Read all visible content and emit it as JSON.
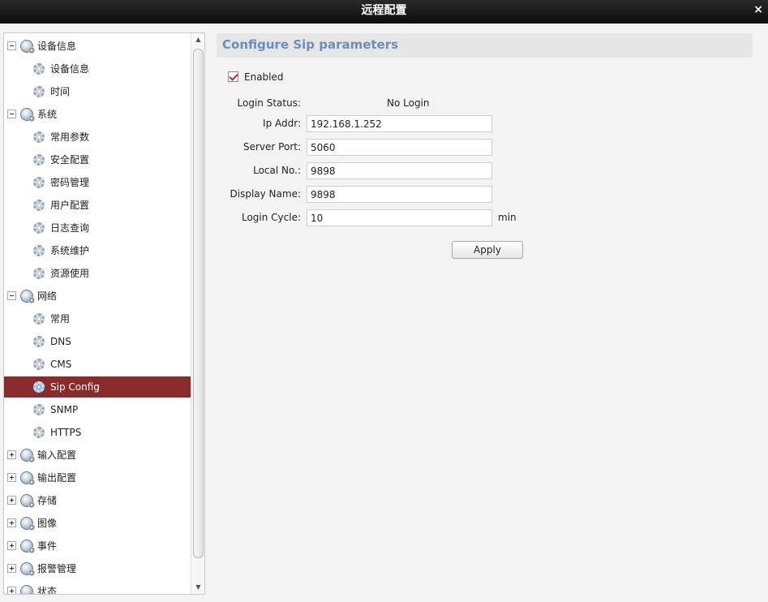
{
  "window": {
    "title": "远程配置",
    "close_icon": "×"
  },
  "tree": {
    "items": [
      {
        "label": "设备信息",
        "level": 0,
        "expanded": true
      },
      {
        "label": "设备信息",
        "level": 1
      },
      {
        "label": "时间",
        "level": 1
      },
      {
        "label": "系统",
        "level": 0,
        "expanded": true
      },
      {
        "label": "常用参数",
        "level": 1
      },
      {
        "label": "安全配置",
        "level": 1
      },
      {
        "label": "密码管理",
        "level": 1
      },
      {
        "label": "用户配置",
        "level": 1
      },
      {
        "label": "日志查询",
        "level": 1
      },
      {
        "label": "系统维护",
        "level": 1
      },
      {
        "label": "资源使用",
        "level": 1
      },
      {
        "label": "网络",
        "level": 0,
        "expanded": true
      },
      {
        "label": "常用",
        "level": 1
      },
      {
        "label": "DNS",
        "level": 1
      },
      {
        "label": "CMS",
        "level": 1
      },
      {
        "label": "Sip Config",
        "level": 1,
        "selected": true
      },
      {
        "label": "SNMP",
        "level": 1
      },
      {
        "label": "HTTPS",
        "level": 1
      },
      {
        "label": "输入配置",
        "level": 0,
        "expanded": false
      },
      {
        "label": "输出配置",
        "level": 0,
        "expanded": false
      },
      {
        "label": "存储",
        "level": 0,
        "expanded": false
      },
      {
        "label": "图像",
        "level": 0,
        "expanded": false
      },
      {
        "label": "事件",
        "level": 0,
        "expanded": false
      },
      {
        "label": "报警管理",
        "level": 0,
        "expanded": false
      },
      {
        "label": "状态",
        "level": 0,
        "expanded": false
      }
    ]
  },
  "panel": {
    "title": "Configure Sip parameters",
    "enabled_label": "Enabled",
    "enabled_checked": true,
    "login_status_label": "Login Status:",
    "login_status_value": "No Login",
    "ip_addr_label": "Ip Addr:",
    "ip_addr_value": "192.168.1.252",
    "server_port_label": "Server Port:",
    "server_port_value": "5060",
    "local_no_label": "Local No.:",
    "local_no_value": "9898",
    "display_name_label": "Display Name:",
    "display_name_value": "9898",
    "login_cycle_label": "Login Cycle:",
    "login_cycle_value": "10",
    "login_cycle_unit": "min",
    "apply_label": "Apply"
  },
  "colors": {
    "title_bar": "#1a1a1a",
    "selected_row": "#8a2b2b",
    "panel_title": "#6c8fb9",
    "check": "#c0262d"
  }
}
